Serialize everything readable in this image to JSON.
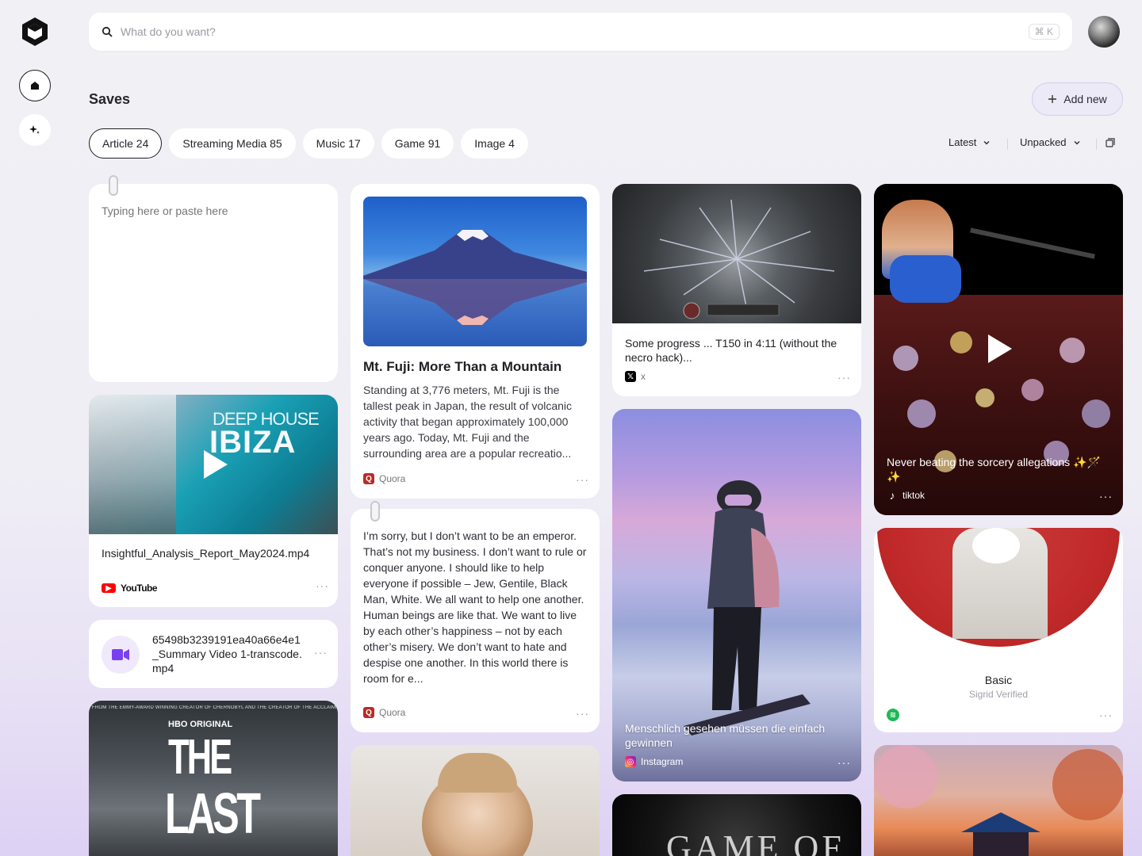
{
  "search": {
    "placeholder": "What do you want?",
    "shortcut": "⌘ K"
  },
  "page": {
    "title": "Saves",
    "add_label": "Add new"
  },
  "filters": [
    {
      "label": "Article 24",
      "active": true
    },
    {
      "label": "Streaming Media 85",
      "active": false
    },
    {
      "label": "Music 17",
      "active": false
    },
    {
      "label": "Game 91",
      "active": false
    },
    {
      "label": "Image 4",
      "active": false
    }
  ],
  "sort": {
    "order": "Latest",
    "state": "Unpacked"
  },
  "cards": {
    "note": {
      "placeholder": "Typing here or paste here"
    },
    "ibiza": {
      "overlay_line1": "DEEP HOUSE",
      "overlay_line2": "IBIZA",
      "title": "Insightful_Analysis_Report_May2024.mp4",
      "source": "YouTube"
    },
    "video_file": {
      "title": "65498b3239191ea40a66e4e1_Summary Video 1-transcode.mp4"
    },
    "lastofus": {
      "tagline": "FROM THE EMMY-AWARD WINNING CREATOR OF CHERNOBYL AND THE CREATOR OF THE ACCLAIMED VIDEO GAME",
      "brand": "HBO ORIGINAL",
      "line1": "THE",
      "line2": "LAST"
    },
    "fuji": {
      "title": "Mt. Fuji: More Than a Mountain",
      "body": "Standing at 3,776 meters, Mt. Fuji is the tallest peak in Japan, the result of volcanic activity that began approximately 100,000 years ago. Today, Mt. Fuji and the surrounding area are a popular recreatio...",
      "source": "Quora"
    },
    "quote": {
      "body": "I’m sorry, but I don’t want to be an emperor. That’s not my business. I don’t want to rule or conquer anyone. I should like to help everyone if possible – Jew, Gentile, Black Man, White. We all want to help one another. Human beings are like that. We want to live by each other’s happiness – not by each other’s misery. We don’t want to hate and despise one another. In this world there is room for e...",
      "source": "Quora"
    },
    "game": {
      "title": "Some progress ... T150 in 4:11 (without the necro hack)...",
      "source": "x"
    },
    "snow": {
      "title": "Menschlich gesehen müssen die einfach gewinnen",
      "source": "Instagram"
    },
    "got": {
      "title": "GAME OF"
    },
    "concert": {
      "title": "Never beating the sorcery allegations ✨🪄✨",
      "source": "tiktok"
    },
    "music": {
      "title": "Basic",
      "artist": "Sigrid Verified"
    }
  },
  "colors": {
    "accent": "#d2cdef",
    "youtube": "#ff0000",
    "quora": "#b92b27",
    "spotify": "#1db954"
  }
}
